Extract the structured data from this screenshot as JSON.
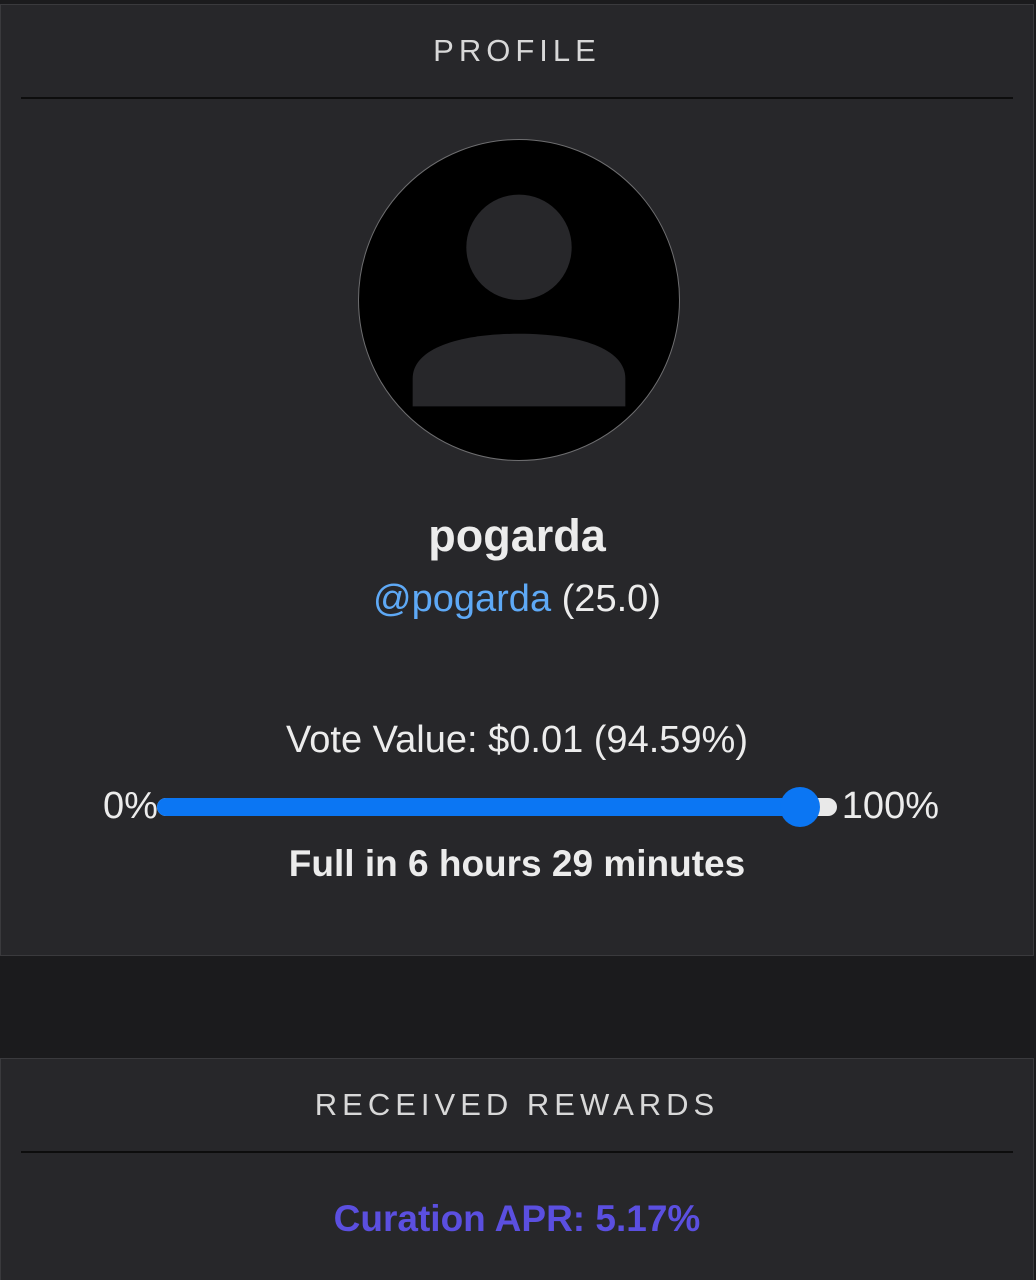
{
  "profile_panel": {
    "header": "PROFILE",
    "display_name": "pogarda",
    "handle": "@pogarda",
    "reputation": "(25.0)",
    "vote_value_label": "Vote Value: $0.01 (94.59%)",
    "slider": {
      "min_label": "0%",
      "max_label": "100%",
      "value_percent": 94.59,
      "fill_color": "#0b76f3",
      "track_color": "#e9e9e9"
    },
    "recharge_text": "Full in 6 hours 29 minutes",
    "avatar_icon": "user-silhouette-icon"
  },
  "rewards_panel": {
    "header": "RECEIVED REWARDS",
    "curation_apr": "Curation APR: 5.17%",
    "apr_color": "#5b4fe0"
  },
  "colors": {
    "background": "#1b1b1d",
    "panel": "#27272a",
    "link": "#5ea9f6"
  }
}
